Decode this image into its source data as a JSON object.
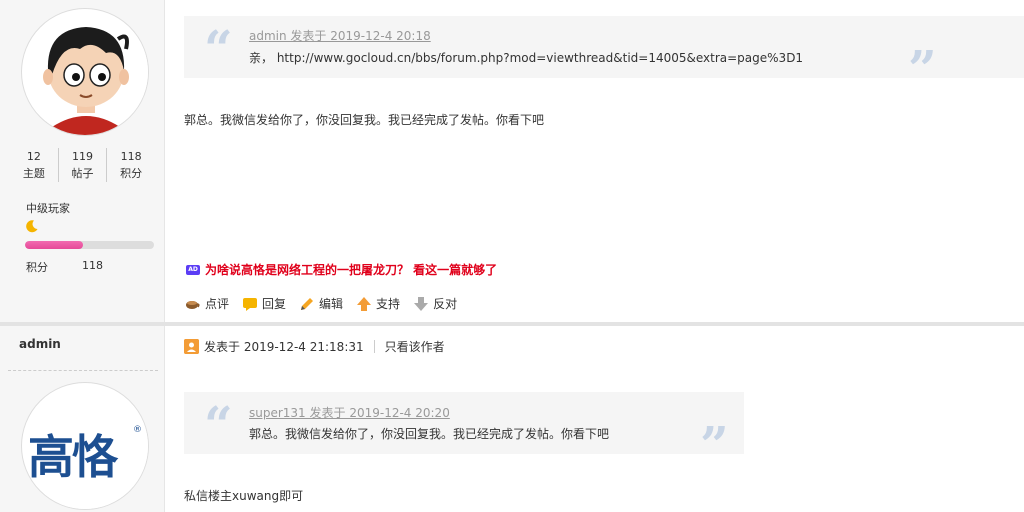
{
  "post1": {
    "stats": [
      {
        "value": "12",
        "label": "主题"
      },
      {
        "value": "119",
        "label": "帖子"
      },
      {
        "value": "118",
        "label": "积分"
      }
    ],
    "level_name": "中级玩家",
    "level_progress": 0.45,
    "points_label": "积分",
    "points_value": "118",
    "quote_head": "admin 发表于 2019-12-4 20:18",
    "quote_body": "亲， http://www.gocloud.cn/bbs/forum.php?mod=viewthread&tid=14005&extra=page%3D1",
    "text": "郭总。我微信发给你了，你没回复我。我已经完成了发帖。你看下吧",
    "promo_badge": "AD",
    "promo": "为啥说高恪是网络工程的一把屠龙刀？ 看这一篇就够了",
    "actions": {
      "rate": "点评",
      "reply": "回复",
      "edit": "编辑",
      "support": "支持",
      "oppose": "反对"
    }
  },
  "post2": {
    "author": "admin",
    "posted": "发表于 2019-12-4 21:18:31",
    "author_only": "只看该作者",
    "logo_text": "高恪",
    "quote_head": "super131 发表于 2019-12-4 20:20",
    "quote_body": "郭总。我微信发给你了，你没回复我。我已经完成了发帖。你看下吧",
    "text": "私信楼主xuwang即可"
  },
  "colors": {
    "accent_pink": "#e64a98",
    "promo_red": "#e0001b",
    "quote_mark": "#c8d5e6",
    "support_orange": "#f39c36"
  },
  "icons": {
    "rate": "coffee-cup-icon",
    "reply": "speech-bubble-icon",
    "edit": "pencil-icon",
    "support": "arrow-up-icon",
    "oppose": "arrow-down-icon",
    "level": "moon-icon"
  }
}
